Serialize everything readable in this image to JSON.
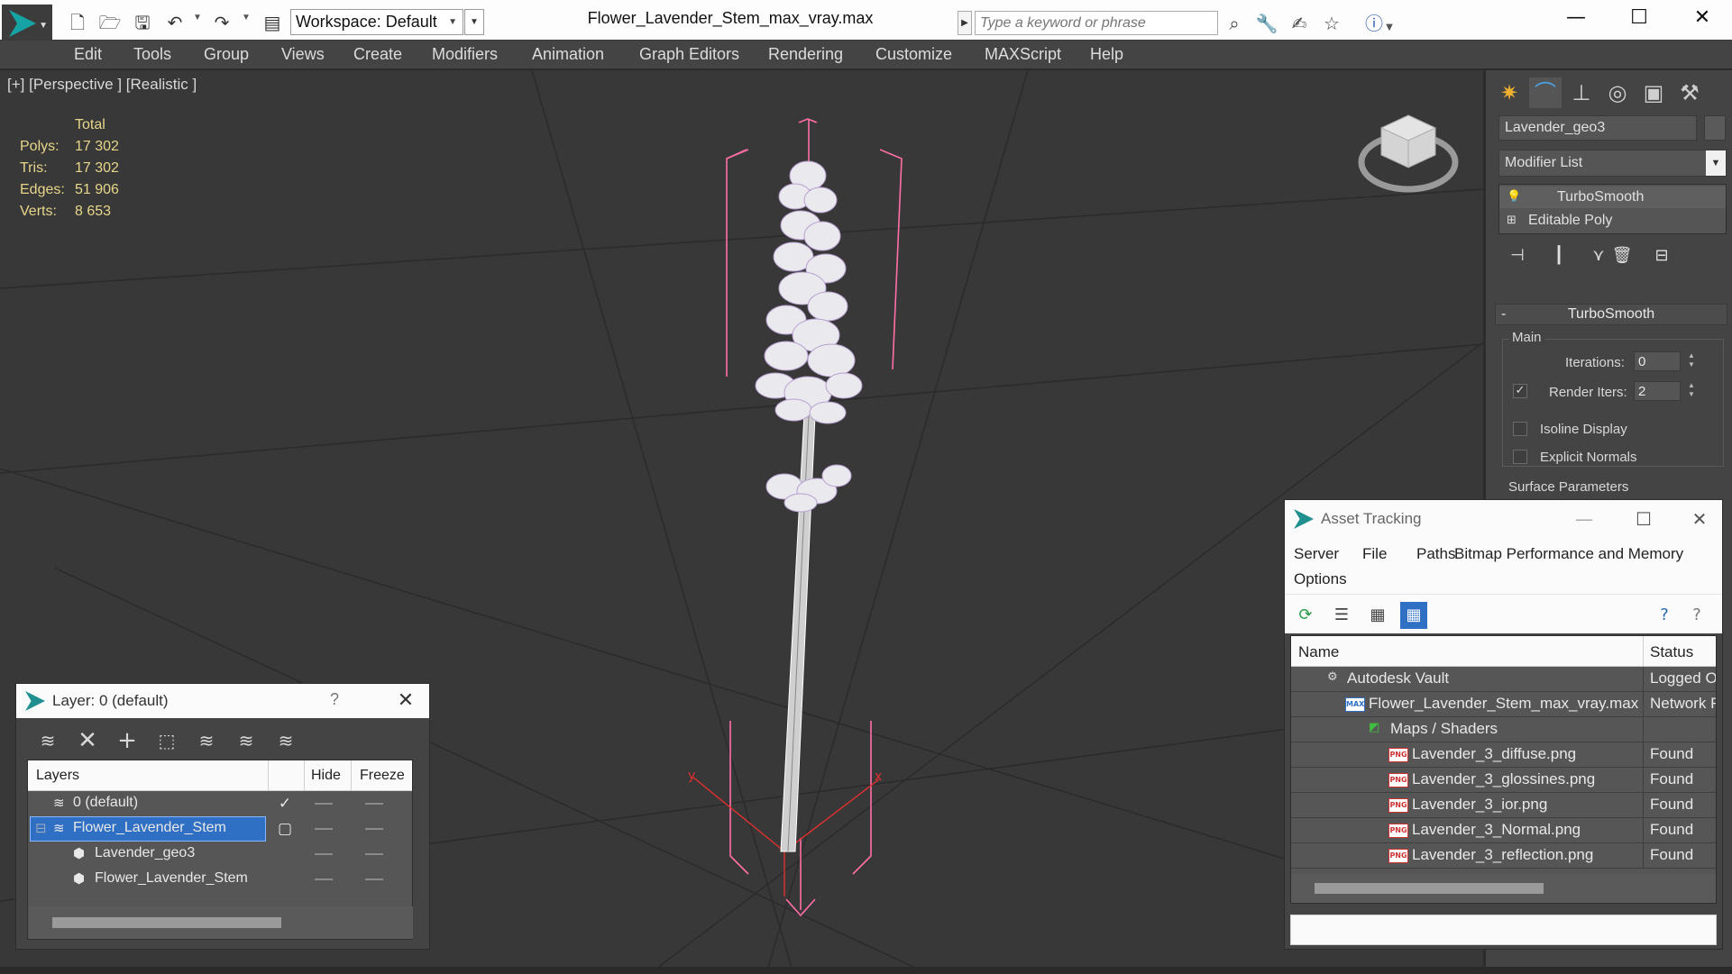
{
  "titlebar": {
    "workspace": "Workspace: Default",
    "document_title": "Flower_Lavender_Stem_max_vray.max",
    "search_placeholder": "Type a keyword or phrase",
    "icons": [
      "new-file-icon",
      "open-folder-icon",
      "save-icon",
      "undo-icon",
      "redo-icon",
      "project-icon",
      "binoculars-icon",
      "wrench-icon",
      "pin-icon",
      "star-icon",
      "help-icon",
      "minimize-icon",
      "maximize-icon",
      "close-icon"
    ]
  },
  "menu": {
    "items": [
      "Edit",
      "Tools",
      "Group",
      "Views",
      "Create",
      "Modifiers",
      "Animation",
      "Graph Editors",
      "Rendering",
      "Customize",
      "MAXScript",
      "Help"
    ]
  },
  "viewport": {
    "label": "[+] [Perspective ] [Realistic ]",
    "stats": {
      "header": "Total",
      "rows": [
        {
          "key": "Polys:",
          "value": "17 302"
        },
        {
          "key": "Tris:",
          "value": "17 302"
        },
        {
          "key": "Edges:",
          "value": "51 906"
        },
        {
          "key": "Verts:",
          "value": "8 653"
        }
      ]
    },
    "gizmo_axis_labels": {
      "y": "y",
      "x": "x"
    }
  },
  "command_panel": {
    "object_name": "Lavender_geo3",
    "modifier_list": "Modifier List",
    "stack": [
      {
        "label": "TurboSmooth",
        "icon": "lightbulb-icon"
      },
      {
        "label": "Editable Poly",
        "icon": "expand-plus-icon"
      }
    ],
    "rollout": {
      "title": "TurboSmooth",
      "main_group": "Main",
      "iterations_label": "Iterations:",
      "iterations_value": "0",
      "render_iters_label": "Render Iters:",
      "render_iters_value": "2",
      "render_iters_checked": true,
      "isoline_label": "Isoline Display",
      "isoline_checked": false,
      "explicit_normals_label": "Explicit Normals",
      "explicit_normals_checked": false,
      "surface_group": "Surface Parameters"
    }
  },
  "layer_window": {
    "title": "Layer: 0 (default)",
    "help": "?",
    "columns": {
      "layers": "Layers",
      "hide": "Hide",
      "freeze": "Freeze"
    },
    "rows": [
      {
        "name": "0 (default)",
        "icon": "layer-stack-icon",
        "current": true,
        "selected": false,
        "indent": 1
      },
      {
        "name": "Flower_Lavender_Stem",
        "icon": "layer-stack-icon",
        "current": false,
        "selected": true,
        "indent": 1
      },
      {
        "name": "Lavender_geo3",
        "icon": "object-icon",
        "current": false,
        "selected": false,
        "indent": 2
      },
      {
        "name": "Flower_Lavender_Stem",
        "icon": "object-icon",
        "current": false,
        "selected": false,
        "indent": 2
      }
    ]
  },
  "asset_window": {
    "title": "Asset Tracking",
    "menu": [
      "Server",
      "File",
      "Paths",
      "Bitmap Performance and Memory",
      "Options"
    ],
    "columns": {
      "name": "Name",
      "status": "Status"
    },
    "rows": [
      {
        "name": "Autodesk Vault",
        "status": "Logged O",
        "type": "vault",
        "indent": 1
      },
      {
        "name": "Flower_Lavender_Stem_max_vray.max",
        "status": "Network F",
        "type": "max",
        "indent": 2
      },
      {
        "name": "Maps / Shaders",
        "status": "",
        "type": "folder",
        "indent": 3
      },
      {
        "name": "Lavender_3_diffuse.png",
        "status": "Found",
        "type": "png",
        "indent": 4
      },
      {
        "name": "Lavender_3_glossines.png",
        "status": "Found",
        "type": "png",
        "indent": 4
      },
      {
        "name": "Lavender_3_ior.png",
        "status": "Found",
        "type": "png",
        "indent": 4
      },
      {
        "name": "Lavender_3_Normal.png",
        "status": "Found",
        "type": "png",
        "indent": 4
      },
      {
        "name": "Lavender_3_reflection.png",
        "status": "Found",
        "type": "png",
        "indent": 4
      }
    ],
    "png_badge": "PNG",
    "max_badge": "MAX"
  }
}
